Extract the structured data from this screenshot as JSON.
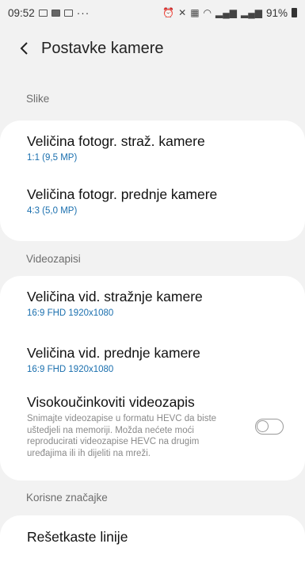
{
  "status_bar": {
    "time": "09:52",
    "more": "···",
    "battery_percent": "91%"
  },
  "header": {
    "title": "Postavke kamere"
  },
  "sections": {
    "pictures": {
      "label": "Slike",
      "items": [
        {
          "title": "Veličina fotogr. straž. kamere",
          "value": "1:1 (9,5 MP)"
        },
        {
          "title": "Veličina fotogr. prednje kamere",
          "value": "4:3 (5,0 MP)"
        }
      ]
    },
    "videos": {
      "label": "Videozapisi",
      "items": [
        {
          "title": "Veličina vid. stražnje kamere",
          "value": "16:9 FHD 1920x1080"
        },
        {
          "title": "Veličina vid. prednje kamere",
          "value": "16:9 FHD 1920x1080"
        },
        {
          "title": "Visokoučinkoviti videozapis",
          "description": "Snimajte videozapise u formatu HEVC da biste uštedjeli na memoriji. Možda nećete moći reproducirati videozapise HEVC na drugim uređajima ili ih dijeliti na mreži.",
          "toggle_on": false
        }
      ]
    },
    "useful": {
      "label": "Korisne značajke",
      "items": [
        {
          "title": "Rešetkaste linije"
        }
      ]
    }
  },
  "colors": {
    "background": "#f2f2f2",
    "card": "#ffffff",
    "value_text": "#1a6fae"
  }
}
